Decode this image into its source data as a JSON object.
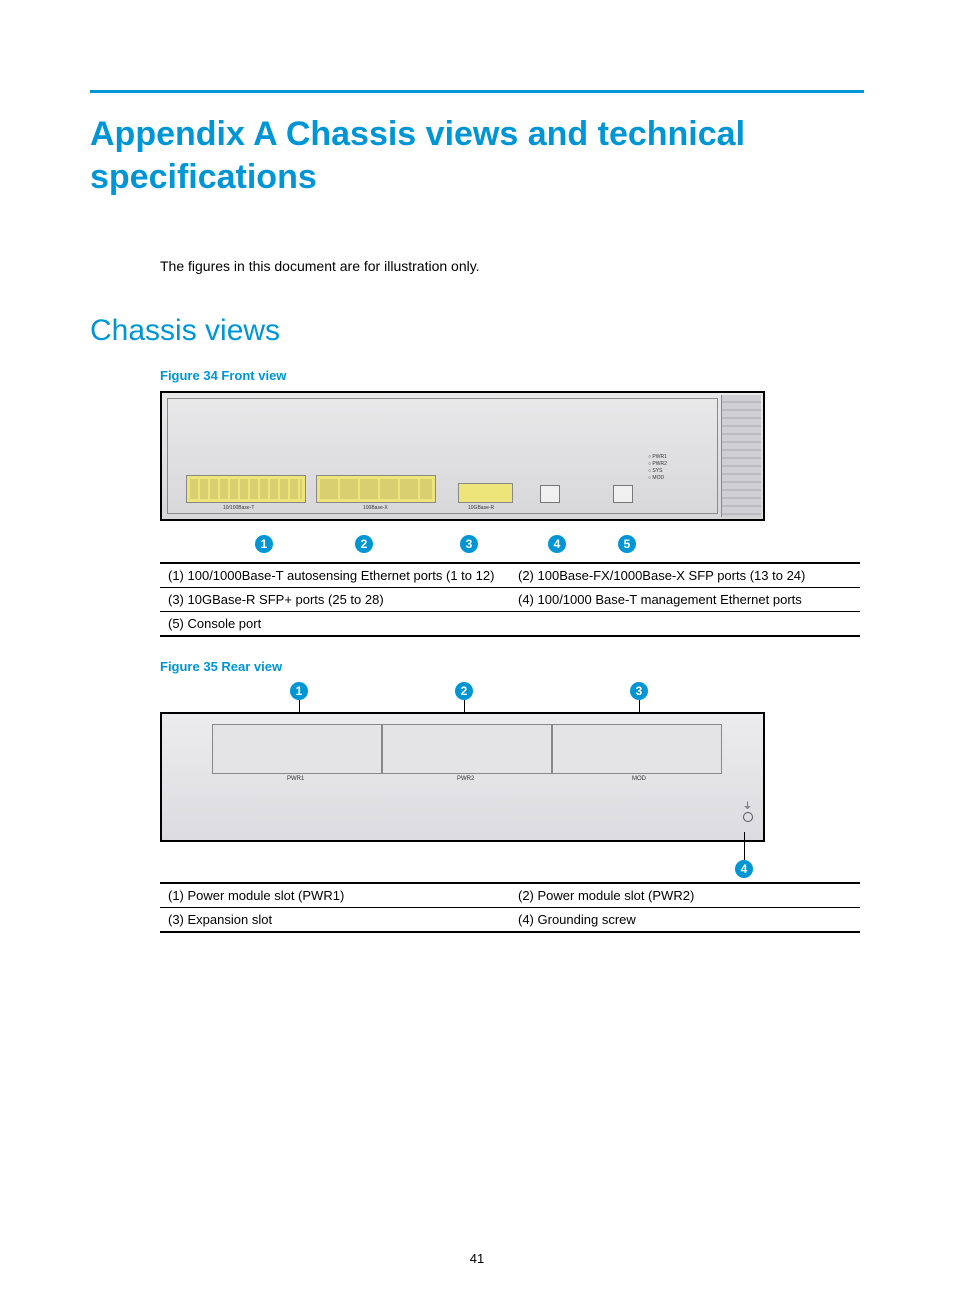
{
  "title": "Appendix A Chassis views and technical specifications",
  "intro": "The figures in this document are for illustration only.",
  "section": "Chassis views",
  "fig34": {
    "caption": "Figure 34 Front view",
    "callouts": [
      "1",
      "2",
      "3",
      "4",
      "5"
    ],
    "leds": [
      "PWR1",
      "PWR2",
      "SYS",
      "MOD"
    ],
    "portlabels": {
      "a": "10/100Base-T",
      "b": "100Base-X",
      "c": "10GBase-R"
    },
    "legend": [
      [
        "(1) 100/1000Base-T autosensing Ethernet ports (1 to 12)",
        "(2) 100Base-FX/1000Base-X SFP ports (13 to 24)"
      ],
      [
        "(3) 10GBase-R SFP+ ports (25 to 28)",
        "(4) 100/1000 Base-T management Ethernet ports"
      ],
      [
        "(5) Console port",
        ""
      ]
    ]
  },
  "fig35": {
    "caption": "Figure 35 Rear view",
    "callouts_top": [
      "1",
      "2",
      "3"
    ],
    "callout_bottom": "4",
    "slotlabels": {
      "pwr1": "PWR1",
      "pwr2": "PWR2",
      "mod": "MOD"
    },
    "legend": [
      [
        "(1) Power module slot (PWR1)",
        "(2) Power module slot (PWR2)"
      ],
      [
        "(3) Expansion slot",
        "(4) Grounding screw"
      ]
    ]
  },
  "page": "41"
}
